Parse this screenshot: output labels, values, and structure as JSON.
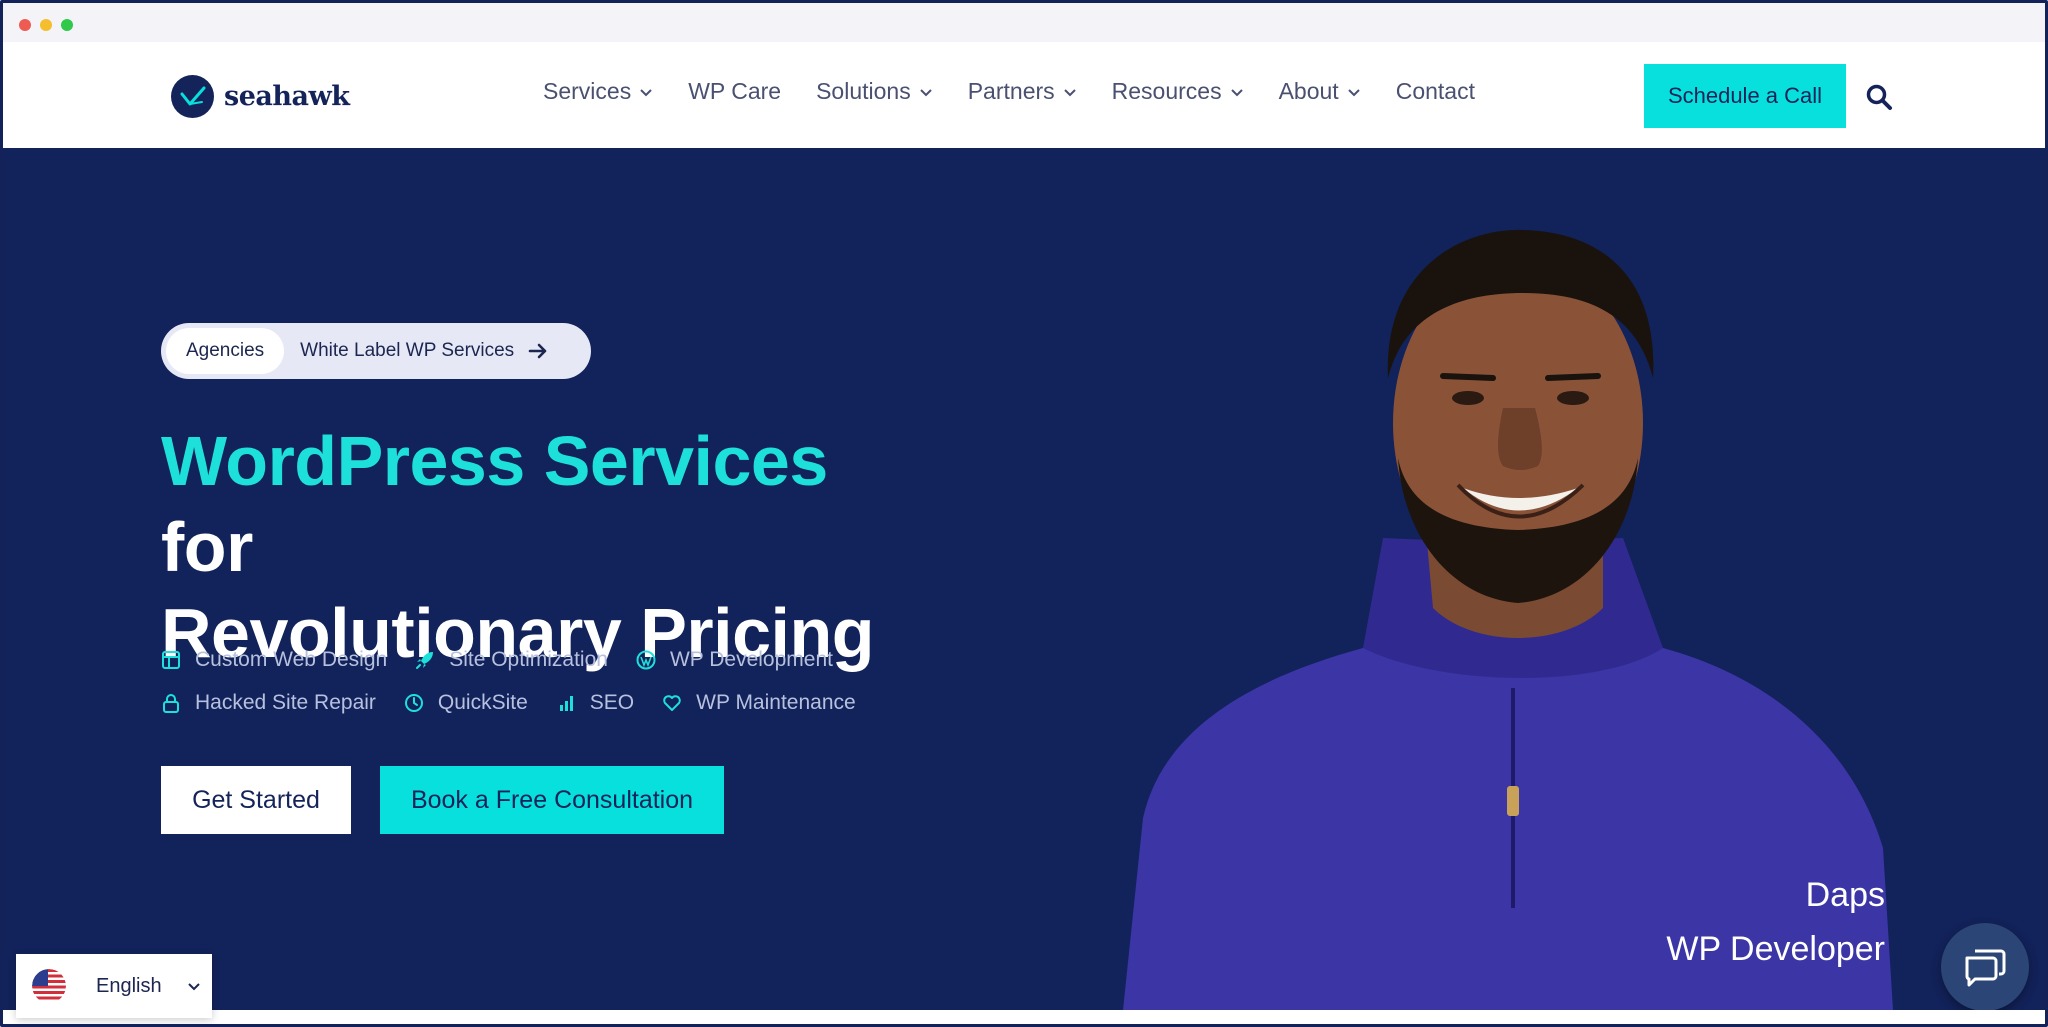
{
  "brand": {
    "name": "seahawk",
    "primary": "#12225a",
    "accent": "#07e0dc",
    "accent_text": "#1ee0da"
  },
  "nav": {
    "items": [
      {
        "label": "Services",
        "has_dropdown": true
      },
      {
        "label": "WP Care",
        "has_dropdown": false
      },
      {
        "label": "Solutions",
        "has_dropdown": true
      },
      {
        "label": "Partners",
        "has_dropdown": true
      },
      {
        "label": "Resources",
        "has_dropdown": true
      },
      {
        "label": "About",
        "has_dropdown": true
      },
      {
        "label": "Contact",
        "has_dropdown": false
      }
    ],
    "cta_label": "Schedule a Call",
    "search_icon": "search-icon"
  },
  "hero": {
    "pill": {
      "tag": "Agencies",
      "text": "White Label WP Services",
      "icon": "arrow-right-icon"
    },
    "headline_accent": "WordPress Services",
    "headline_rest_1": " for",
    "headline_line_2": "Revolutionary Pricing",
    "features_row1": [
      {
        "label": "Custom Web Design",
        "icon": "layout-icon"
      },
      {
        "label": "Site Optimization",
        "icon": "rocket-icon"
      },
      {
        "label": "WP Development",
        "icon": "wordpress-icon"
      }
    ],
    "features_row2": [
      {
        "label": "Hacked Site Repair",
        "icon": "lock-icon"
      },
      {
        "label": "QuickSite",
        "icon": "clock-icon"
      },
      {
        "label": "SEO",
        "icon": "bar-chart-icon"
      },
      {
        "label": "WP Maintenance",
        "icon": "heart-icon"
      }
    ],
    "primary_button": "Get Started",
    "secondary_button": "Book a Free Consultation",
    "person_name": "Daps",
    "person_role": "WP Developer"
  },
  "language": {
    "selected": "English",
    "flag": "us-flag-icon"
  },
  "chat": {
    "icon": "chat-icon"
  }
}
